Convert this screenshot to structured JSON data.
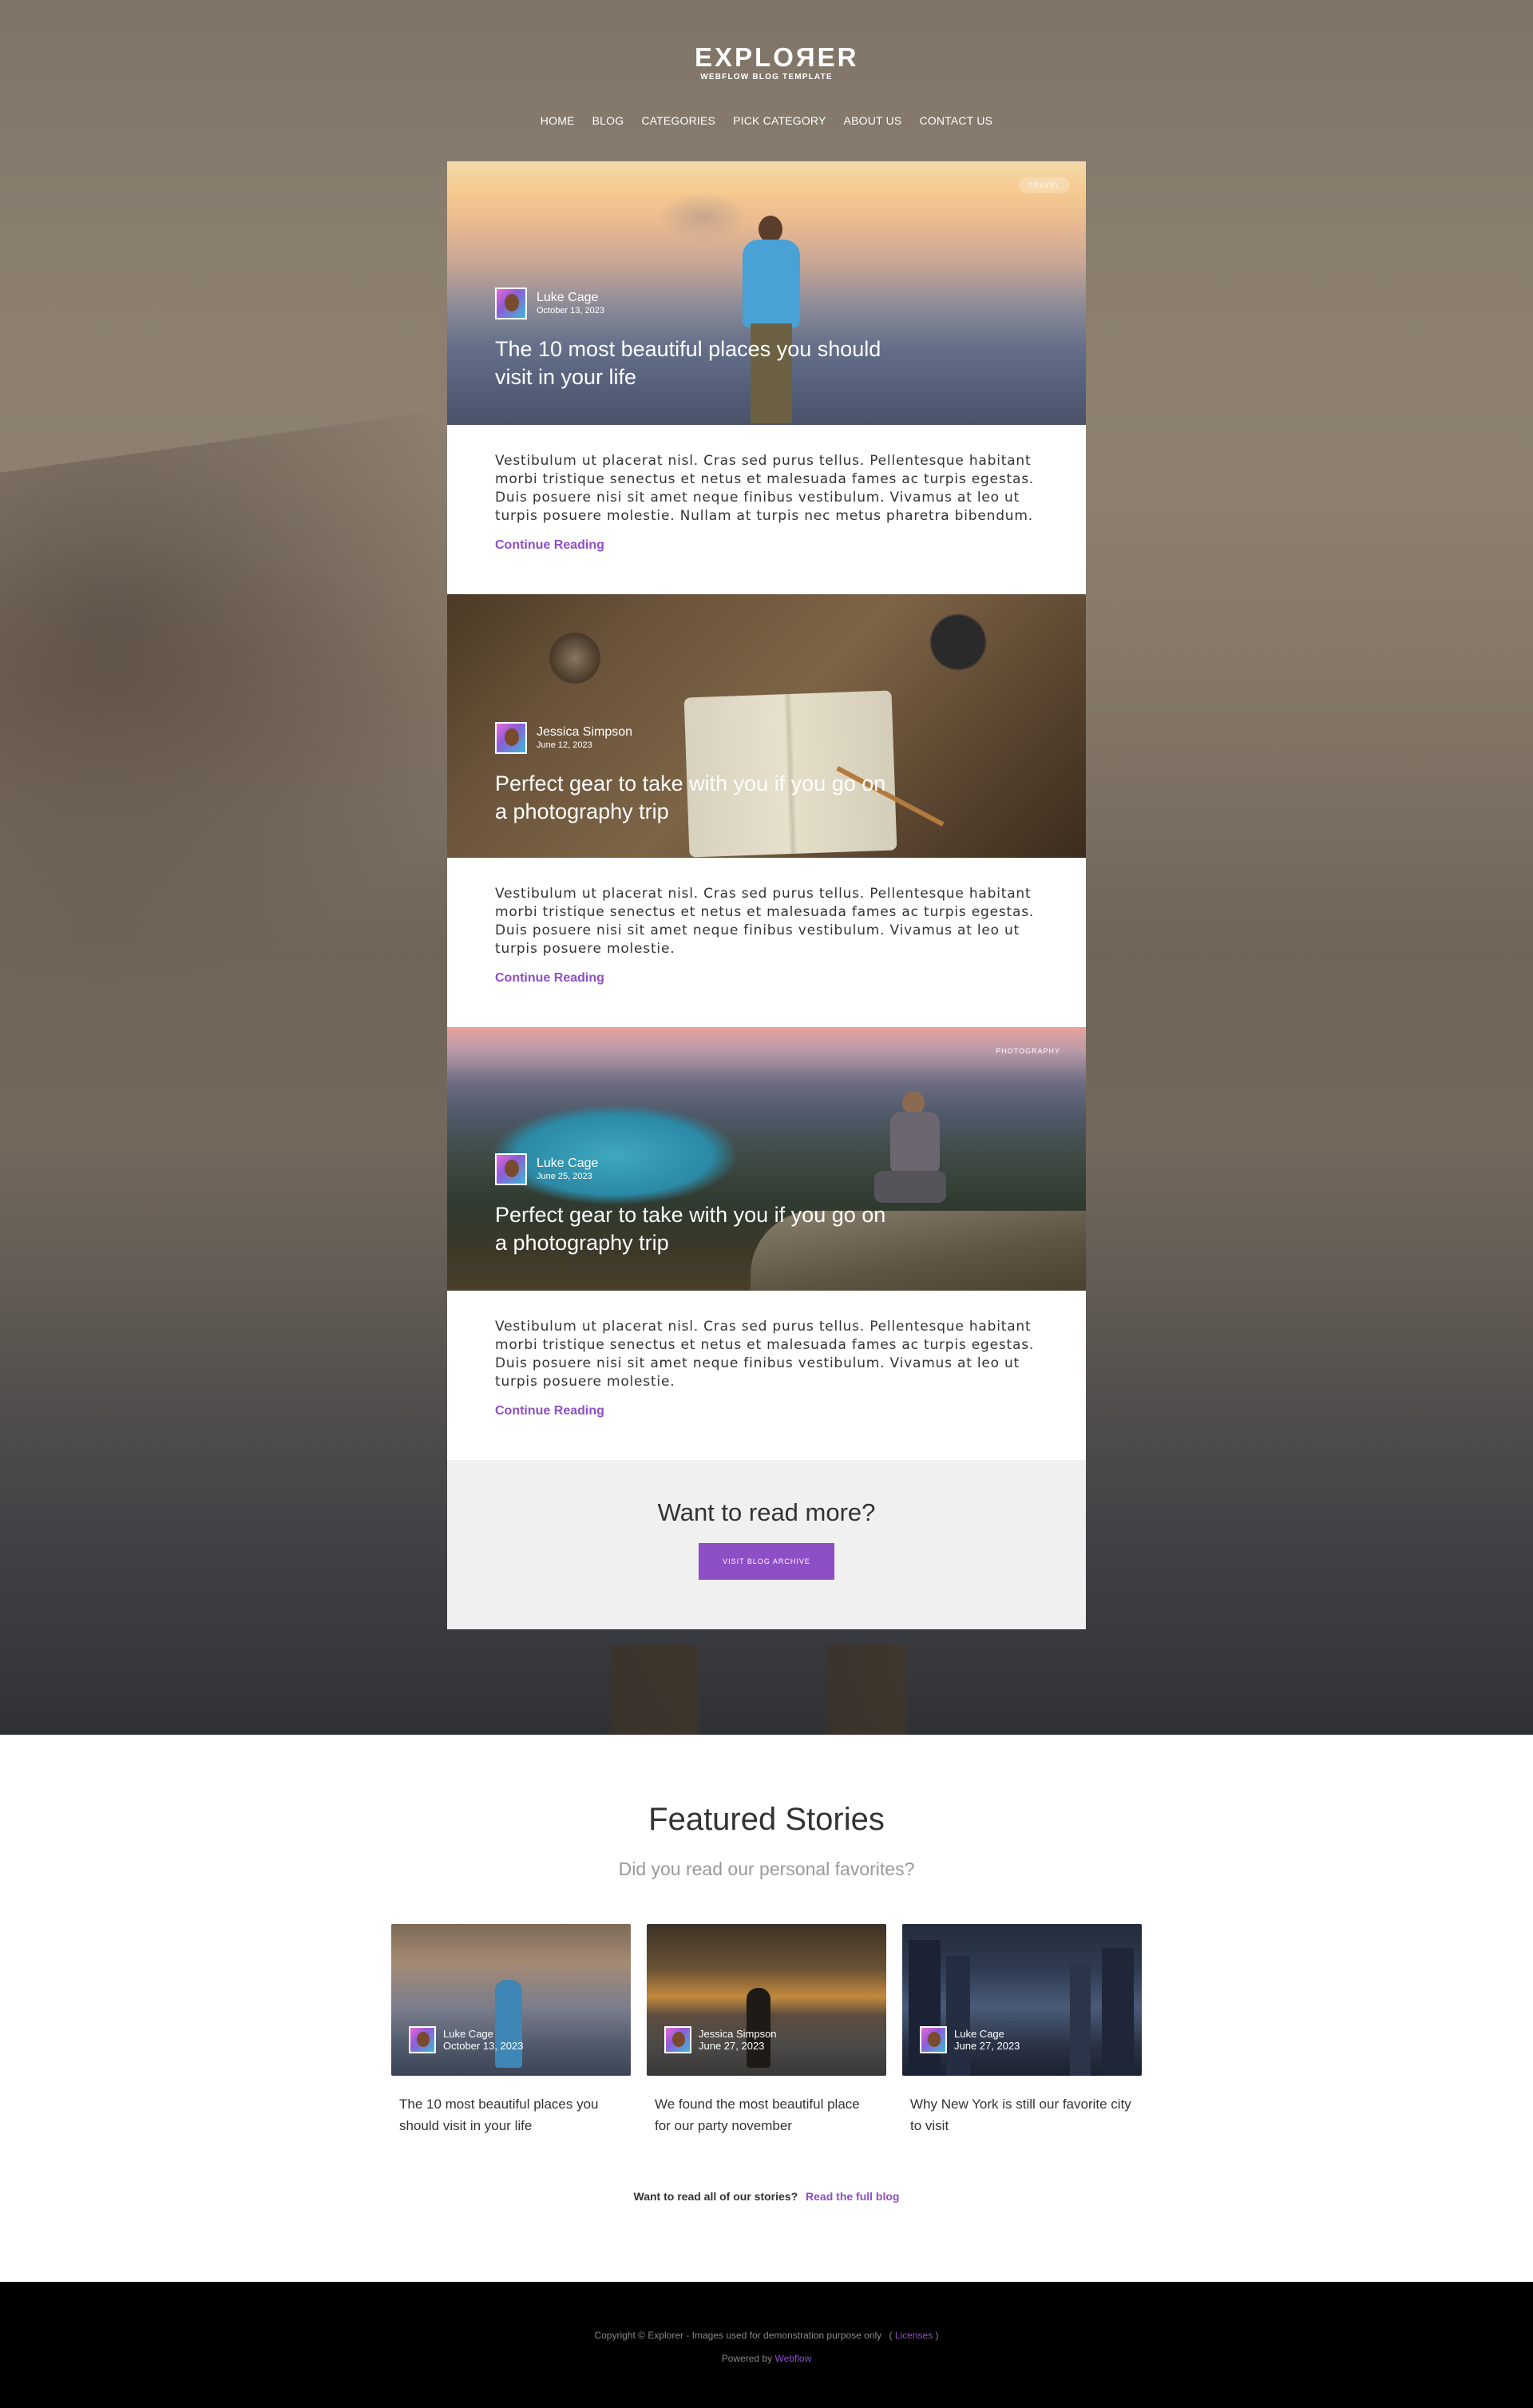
{
  "header": {
    "logo_title": "EXPLOЯER",
    "logo_subtitle": "WEBFLOW BLOG TEMPLATE",
    "nav": [
      "HOME",
      "BLOG",
      "CATEGORIES",
      "PICK CATEGORY",
      "ABOUT US",
      "CONTACT US"
    ]
  },
  "posts": [
    {
      "tag": "TRAVEL",
      "author": "Luke Cage",
      "date": "October 13, 2023",
      "title": "The 10 most beautiful places you should visit in your life",
      "excerpt": "Vestibulum ut placerat nisl. Cras sed purus tellus. Pellentesque habitant morbi tristique senectus et netus et malesuada fames ac turpis egestas. Duis posuere nisi sit amet neque finibus vestibulum. Vivamus at leo ut turpis posuere molestie. Nullam at turpis nec metus pharetra bibendum.",
      "cta": "Continue Reading"
    },
    {
      "tag": "",
      "author": "Jessica Simpson",
      "date": "June 12, 2023",
      "title": "Perfect gear to take with you if you go on a photography trip",
      "excerpt": "Vestibulum ut placerat nisl. Cras sed purus tellus. Pellentesque habitant morbi tristique senectus et netus et malesuada fames ac turpis egestas. Duis posuere nisi sit amet neque finibus vestibulum. Vivamus at leo ut turpis posuere molestie.",
      "cta": "Continue Reading"
    },
    {
      "tag": "PHOTOGRAPHY",
      "author": "Luke Cage",
      "date": "June 25, 2023",
      "title": "Perfect gear to take with you if you go on a photography trip",
      "excerpt": "Vestibulum ut placerat nisl. Cras sed purus tellus. Pellentesque habitant morbi tristique senectus et netus et malesuada fames ac turpis egestas. Duis posuere nisi sit amet neque finibus vestibulum. Vivamus at leo ut turpis posuere molestie.",
      "cta": "Continue Reading"
    }
  ],
  "more": {
    "title": "Want to read more?",
    "button": "VISIT BLOG ARCHIVE"
  },
  "featured": {
    "title": "Featured Stories",
    "subtitle": "Did you read our personal favorites?",
    "cards": [
      {
        "author": "Luke Cage",
        "date": "October 13, 2023",
        "title": "The 10 most beautiful places you should visit in your life"
      },
      {
        "author": "Jessica Simpson",
        "date": "June 27, 2023",
        "title": "We found the most beautiful place for our party november"
      },
      {
        "author": "Luke Cage",
        "date": "June 27, 2023",
        "title": "Why New York is still our favorite city to visit"
      }
    ],
    "read_all_question": "Want to read all of our stories?",
    "read_all_link": "Read the full blog"
  },
  "footer": {
    "copyright": "Copyright © Explorer - Images used for demonstration purpose only",
    "licenses_open": "(",
    "licenses": "Licenses",
    "licenses_close": ")",
    "powered_by": "Powered by",
    "webflow": "Webflow"
  },
  "colors": {
    "accent": "#8e4ec6",
    "footer_bg": "#000000",
    "more_box_bg": "#f1f0f1"
  }
}
